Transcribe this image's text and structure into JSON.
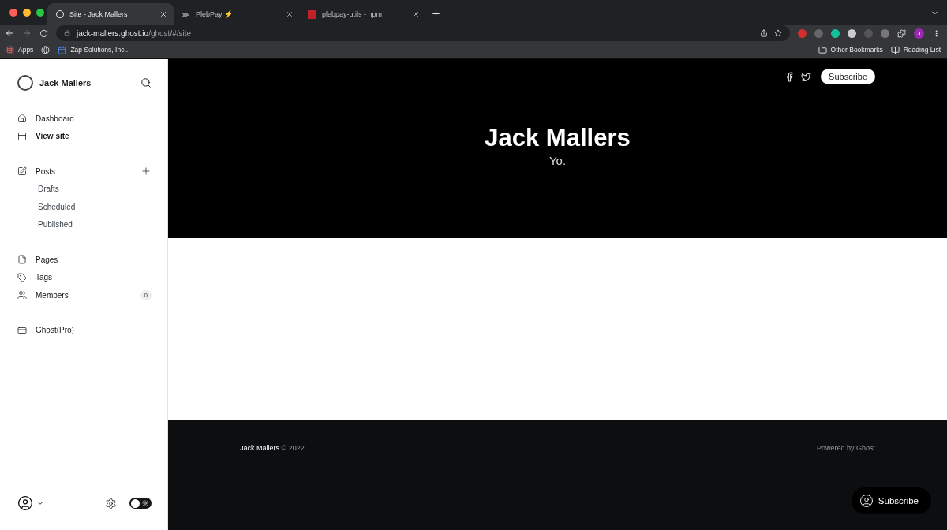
{
  "browser": {
    "tabs": [
      {
        "kind": "ghost",
        "title": "Site - Jack Mallers",
        "selected": true
      },
      {
        "kind": "plebpay",
        "title": "PlebPay ⚡",
        "selected": false
      },
      {
        "kind": "npm",
        "title": "plebpay-utils - npm",
        "selected": false
      }
    ],
    "url": {
      "host": "jack-mallers.ghost.io",
      "path": "/ghost/#/site"
    },
    "profile_letter": "J",
    "bookmarks": [
      {
        "kind": "apps",
        "label": "Apps"
      },
      {
        "kind": "globe"
      },
      {
        "kind": "calendar",
        "label": "Zap Solutions, Inc..."
      }
    ],
    "other_bookmarks": "Other Bookmarks",
    "reading_list": "Reading List"
  },
  "sidebar": {
    "site_title": "Jack Mallers",
    "groups": [
      [
        {
          "kind": "home",
          "label": "Dashboard",
          "selected": false
        },
        {
          "kind": "layout",
          "label": "View site",
          "selected": true
        }
      ],
      [
        {
          "kind": "posts",
          "label": "Posts",
          "selected": false,
          "add": true,
          "children": [
            {
              "label": "Drafts",
              "selected": false
            },
            {
              "label": "Scheduled",
              "selected": false
            },
            {
              "label": "Published",
              "selected": false
            }
          ]
        }
      ],
      [
        {
          "kind": "pages",
          "label": "Pages",
          "selected": false
        },
        {
          "kind": "tag",
          "label": "Tags",
          "selected": false
        },
        {
          "kind": "members",
          "label": "Members",
          "selected": false,
          "badge": "0"
        }
      ],
      [
        {
          "kind": "pro",
          "label": "Ghost(Pro)",
          "selected": false
        }
      ]
    ],
    "dark_mode": false
  },
  "site": {
    "title": "Jack Mallers",
    "description": "Yo.",
    "subscribe": "Subscribe",
    "footer": {
      "name": "Jack Mallers",
      "copyright": "© 2022",
      "powered": "Powered by Ghost"
    },
    "portal_button": "Subscribe"
  }
}
